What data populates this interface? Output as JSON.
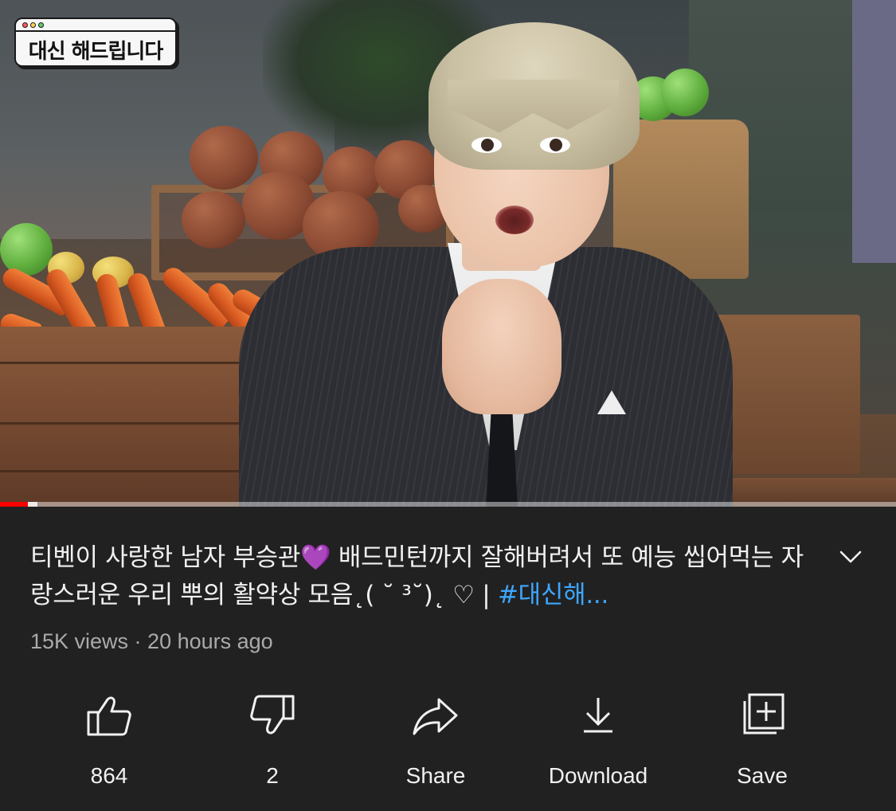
{
  "video": {
    "channel_logo_text": "대신 해드립니다",
    "progress_fraction": 0.031
  },
  "title": {
    "text": "티벤이 사랑한 남자 부승관💜 배드민턴까지 잘해버려서 또 예능 씹어먹는 자랑스러운 우리 뿌의 활약상 모음˛( ˘ ³˘)˛ ♡ | ",
    "hashtag": "#대신해..."
  },
  "meta": {
    "views_and_time": "15K views · 20 hours ago"
  },
  "actions": {
    "like": {
      "label": "864",
      "icon": "thumbs-up-icon"
    },
    "dislike": {
      "label": "2",
      "icon": "thumbs-down-icon"
    },
    "share": {
      "label": "Share",
      "icon": "share-arrow-icon"
    },
    "download": {
      "label": "Download",
      "icon": "download-icon"
    },
    "save": {
      "label": "Save",
      "icon": "add-to-playlist-icon"
    }
  },
  "colors": {
    "background": "#212121",
    "hashtag": "#3ea6ff",
    "progress_played": "#ff0000",
    "meta_text": "#aaaaaa"
  }
}
